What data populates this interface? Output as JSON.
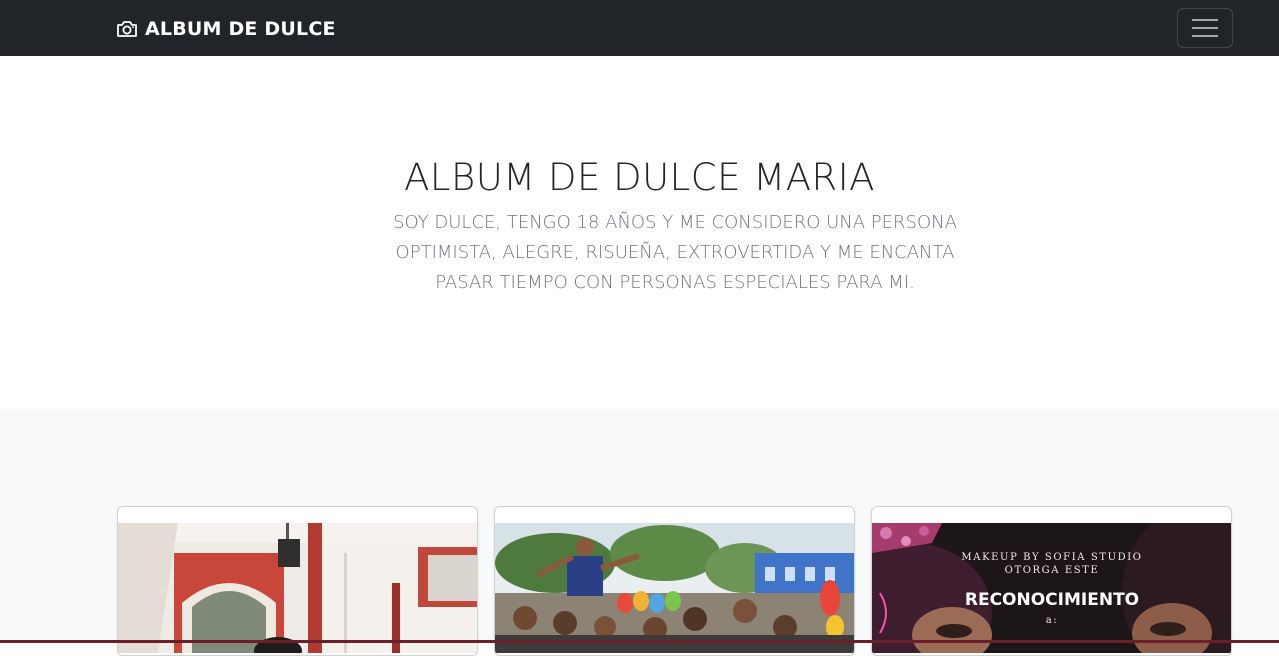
{
  "navbar": {
    "brand": "ALBUM DE DULCE",
    "brand_icon": "camera-icon",
    "menu_icon": "hamburger-menu-icon"
  },
  "hero": {
    "title": "ALBUM DE DULCE MARIA",
    "lead": "SOY DULCE, TENGO 18 AÑOS Y ME CONSIDERO UNA PERSONA OPTIMISTA, ALEGRE, RISUEÑA, EXTROVERTIDA Y ME ENCANTA PASAR TIEMPO CON PERSONAS ESPECIALES PARA MI."
  },
  "cards": [
    {
      "image": "party-hall-photo"
    },
    {
      "image": "group-celebration-photo"
    },
    {
      "image": "makeup-certificate-photo",
      "cert_line1": "MAKEUP BY SOFIA STUDIO",
      "cert_line2": "OTORGA ESTE",
      "cert_title": "RECONOCIMIENTO",
      "cert_line3": "a:"
    }
  ],
  "colors": {
    "navbar_bg": "#212529",
    "hero_text": "#212529",
    "muted_text": "#6c757d",
    "album_bg": "#f8f9fa"
  }
}
